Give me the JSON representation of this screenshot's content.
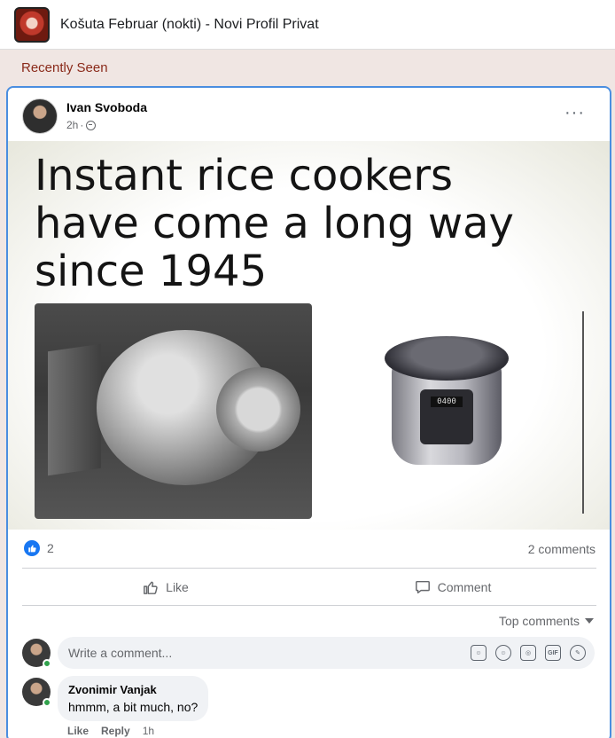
{
  "group": {
    "title": "Košuta Februar (nokti) - Novi Profil Privat"
  },
  "feed": {
    "section_label": "Recently Seen"
  },
  "post": {
    "author": "Ivan Svoboda",
    "time": "2h",
    "dot": "·",
    "meme_text": "Instant rice cookers have come a long way since 1945",
    "cooker_display": "0400",
    "reactions_count": "2",
    "comments_count": "2 comments",
    "like_label": "Like",
    "comment_label": "Comment",
    "top_comments_label": "Top comments",
    "comment_placeholder": "Write a comment...",
    "gif_label": "GIF"
  },
  "comments": [
    {
      "author": "Zvonimir Vanjak",
      "text": "hmmm, a bit much, no?",
      "like": "Like",
      "reply": "Reply",
      "time": "1h"
    }
  ],
  "colors": {
    "accent": "#1877f2",
    "card_border": "#4a8ee0",
    "section_label": "#8a2a1a",
    "online": "#31a24c"
  }
}
